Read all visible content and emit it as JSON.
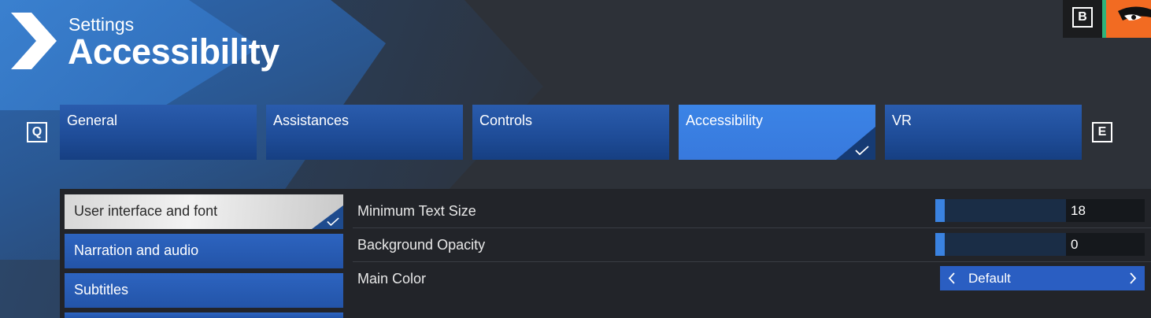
{
  "header": {
    "breadcrumb": "Settings",
    "title": "Accessibility",
    "back_key": "B"
  },
  "tabs": {
    "prev_key": "Q",
    "next_key": "E",
    "items": [
      {
        "label": "General"
      },
      {
        "label": "Assistances"
      },
      {
        "label": "Controls"
      },
      {
        "label": "Accessibility"
      },
      {
        "label": "VR"
      }
    ],
    "active": "Accessibility"
  },
  "categories": [
    {
      "label": "User interface and font"
    },
    {
      "label": "Narration and audio"
    },
    {
      "label": "Subtitles"
    }
  ],
  "settings": {
    "min_text_size": {
      "label": "Minimum Text Size",
      "value": "18"
    },
    "background_opacity": {
      "label": "Background Opacity",
      "value": "0"
    },
    "main_color": {
      "label": "Main Color",
      "value": "Default"
    }
  },
  "colors": {
    "accent": "#3b84e6",
    "tab": "#1f4d99",
    "panel": "#222429",
    "background": "#2d3138"
  }
}
